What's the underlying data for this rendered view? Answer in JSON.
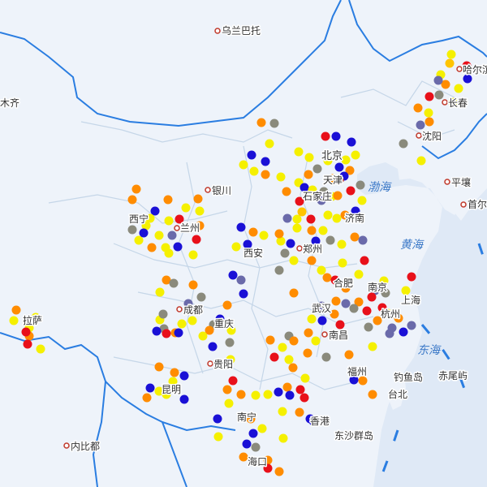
{
  "colors": {
    "land": "#eef3fa",
    "sea": "#dfe9f6",
    "border_country": "#2a7de1",
    "border_province": "#c5d6e8",
    "city_dot": "#c0392b",
    "blue": "#1a10d6",
    "slate": "#6a6aaa",
    "gray": "#8a8a7c",
    "red": "#e8101a",
    "orange": "#ff8c00",
    "amber": "#ffc400",
    "yellow": "#f5f000"
  },
  "map": {
    "labels": {
      "wulanbatuo": "乌兰巴托",
      "muqi": "木齐",
      "haerbin": "哈尔滨",
      "changchun": "长春",
      "shenyang": "沈阳",
      "beijing": "北京",
      "tianjin": "天津",
      "shijiazhuang": "石家庄",
      "pingrang": "平壤",
      "shouer": "首尔",
      "yinchuan": "银川",
      "xining": "西宁",
      "lanzhou": "兰州",
      "jinan": "济南",
      "xian": "西安",
      "zhengzhou": "郑州",
      "hefei": "合肥",
      "nanjing": "南京",
      "shanghai": "上海",
      "wuhan": "武汉",
      "hangzhou": "杭州",
      "chengdu": "成都",
      "chongqing": "重庆",
      "nanchang": "南昌",
      "lasa": "拉萨",
      "guiyang": "贵阳",
      "fuzhou": "福州",
      "diaoyudao": "钓鱼岛",
      "chiweiyu": "赤尾屿",
      "taibei": "台北",
      "kunming": "昆明",
      "nanning": "南宁",
      "xianggang": "香港",
      "dongsha": "东沙群岛",
      "haikou": "海口",
      "neibidu": "内比都"
    },
    "seas": {
      "bohai": "渤海",
      "huanghai": "黄海",
      "donghai": "东海"
    }
  }
}
